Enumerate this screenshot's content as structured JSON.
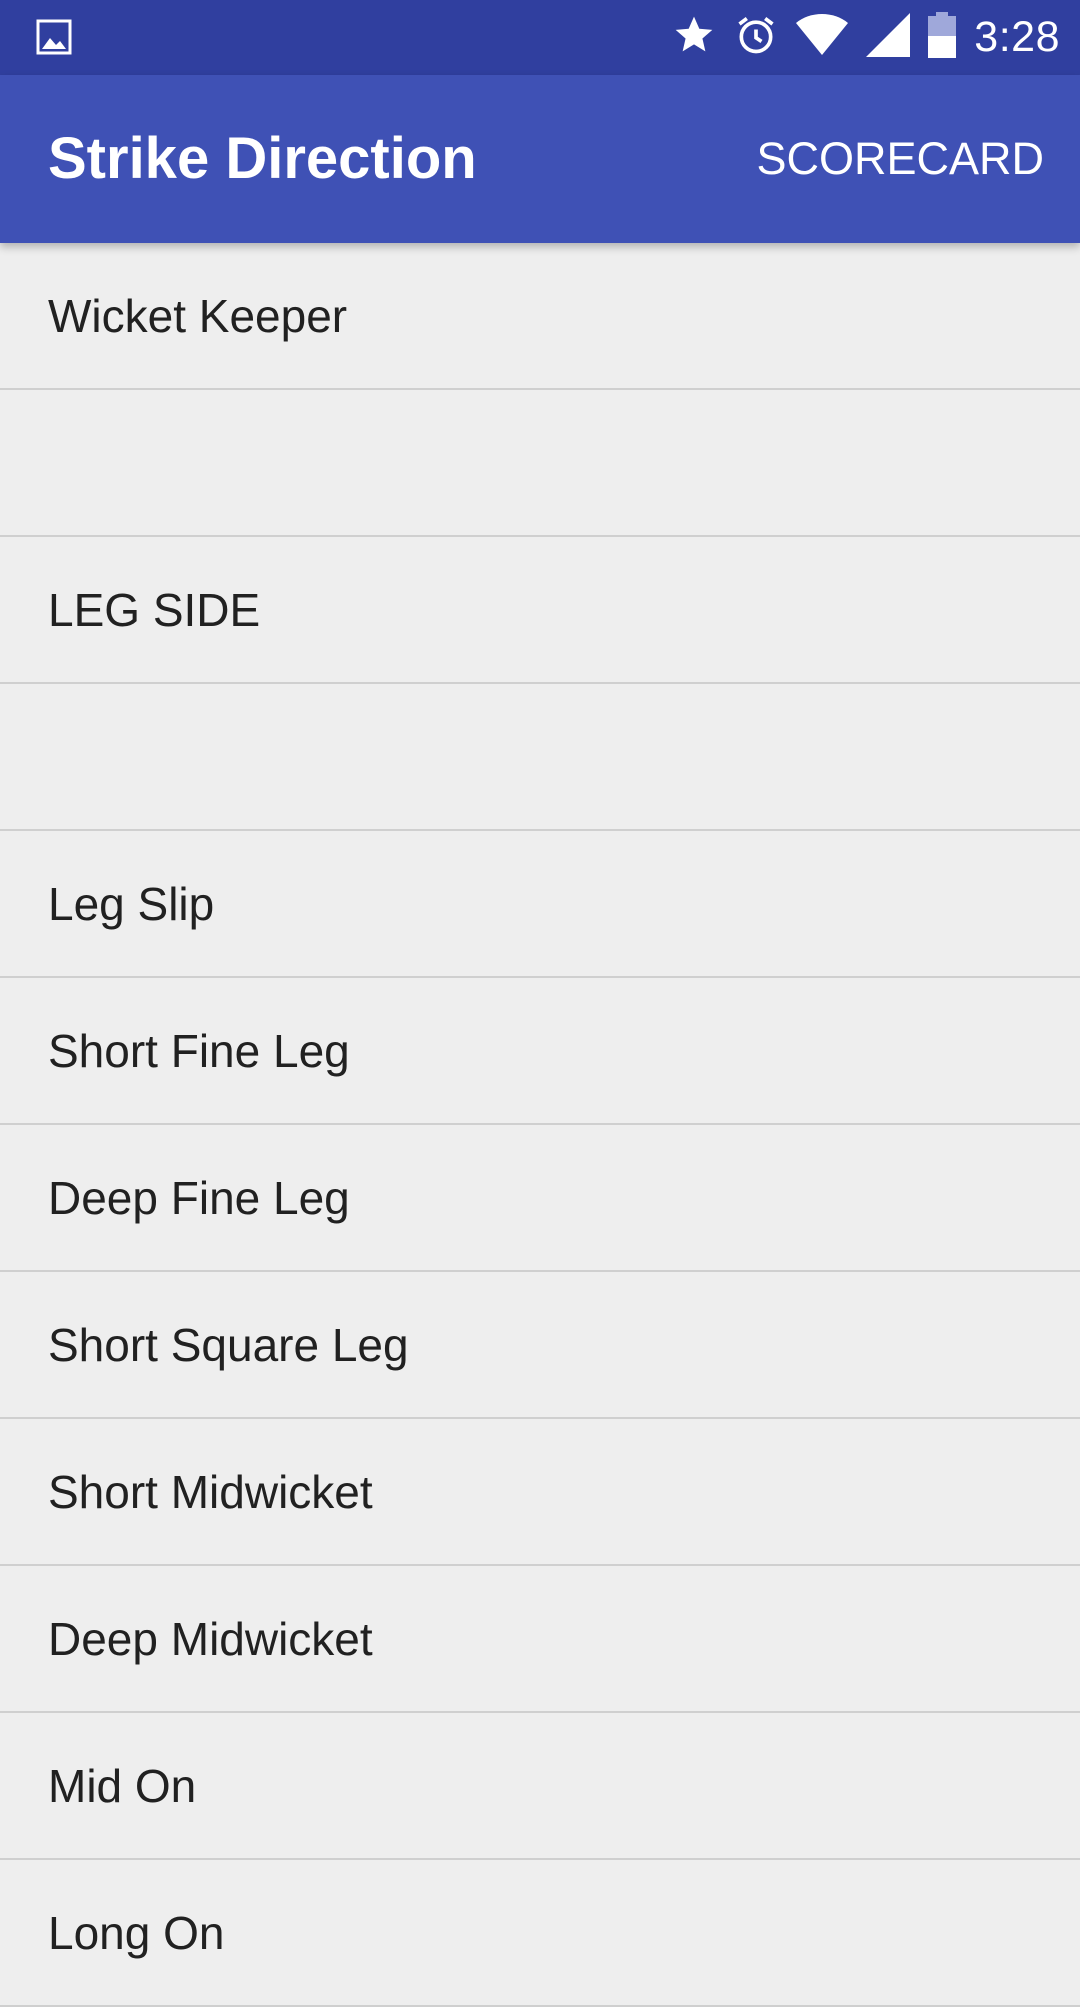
{
  "status_bar": {
    "time": "3:28",
    "icons": [
      "image-icon",
      "star-icon",
      "alarm-icon",
      "wifi-icon",
      "signal-icon",
      "battery-icon"
    ]
  },
  "app_bar": {
    "title": "Strike Direction",
    "action_label": "SCORECARD",
    "colors": {
      "status_bar": "#303f9f",
      "app_bar": "#3f51b5"
    }
  },
  "list": {
    "items": [
      {
        "label": "Wicket Keeper"
      },
      {
        "label": ""
      },
      {
        "label": "LEG SIDE"
      },
      {
        "label": ""
      },
      {
        "label": "Leg Slip"
      },
      {
        "label": "Short Fine Leg"
      },
      {
        "label": "Deep Fine Leg"
      },
      {
        "label": "Short Square Leg"
      },
      {
        "label": "Short Midwicket"
      },
      {
        "label": "Deep Midwicket"
      },
      {
        "label": "Mid On"
      },
      {
        "label": "Long On"
      }
    ]
  }
}
